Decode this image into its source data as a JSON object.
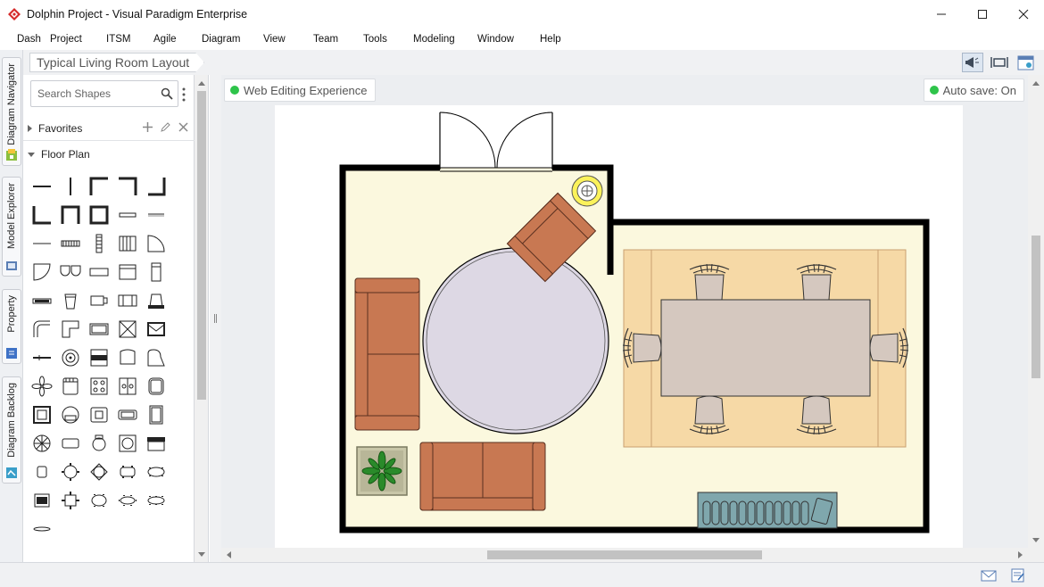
{
  "window": {
    "title": "Dolphin Project - Visual Paradigm Enterprise",
    "controls": [
      "minimize",
      "maximize",
      "close"
    ]
  },
  "menu": [
    "Dash",
    "Project",
    "ITSM",
    "Agile",
    "Diagram",
    "View",
    "Team",
    "Tools",
    "Modeling",
    "Window",
    "Help"
  ],
  "side_tabs": [
    "Diagram Navigator",
    "Model Explorer",
    "Property",
    "Diagram Backlog"
  ],
  "breadcrumb": "Typical Living Room Layout",
  "shapes_panel": {
    "search_placeholder": "Search Shapes",
    "sections": [
      {
        "label": "Favorites",
        "expanded": false
      },
      {
        "label": "Floor Plan",
        "expanded": true
      }
    ]
  },
  "canvas": {
    "badge_left": "Web Editing Experience",
    "badge_right": "Auto save: On"
  },
  "colors": {
    "status_dot": "#2ec44a",
    "floor": "#fbf8de",
    "rug": "#f6d9a6",
    "sofa": "#c87852",
    "table": "#d5c8bf",
    "round_rug": "#ddd8e4",
    "radiator": "#7fa7ad",
    "wall": "#000000"
  }
}
